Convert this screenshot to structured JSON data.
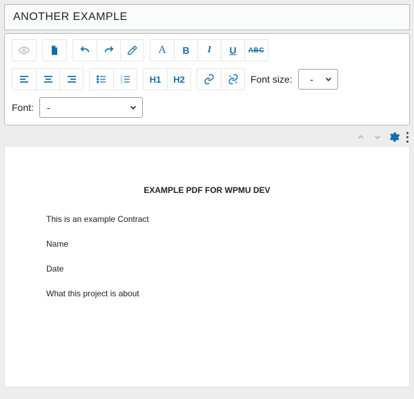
{
  "title_input": {
    "value": "ANOTHER EXAMPLE"
  },
  "toolbar": {
    "font_size_label": "Font size:",
    "font_size_value": "-",
    "font_label": "Font:",
    "font_value": "-"
  },
  "headings": {
    "h1": "H1",
    "h2": "H2"
  },
  "format": {
    "bold": "B",
    "italic": "I",
    "underline": "U",
    "strike": "ABC"
  },
  "document": {
    "heading": "EXAMPLE PDF FOR WPMU DEV",
    "lines": [
      "This is an example Contract",
      "Name",
      "Date",
      "What this project is about"
    ]
  }
}
